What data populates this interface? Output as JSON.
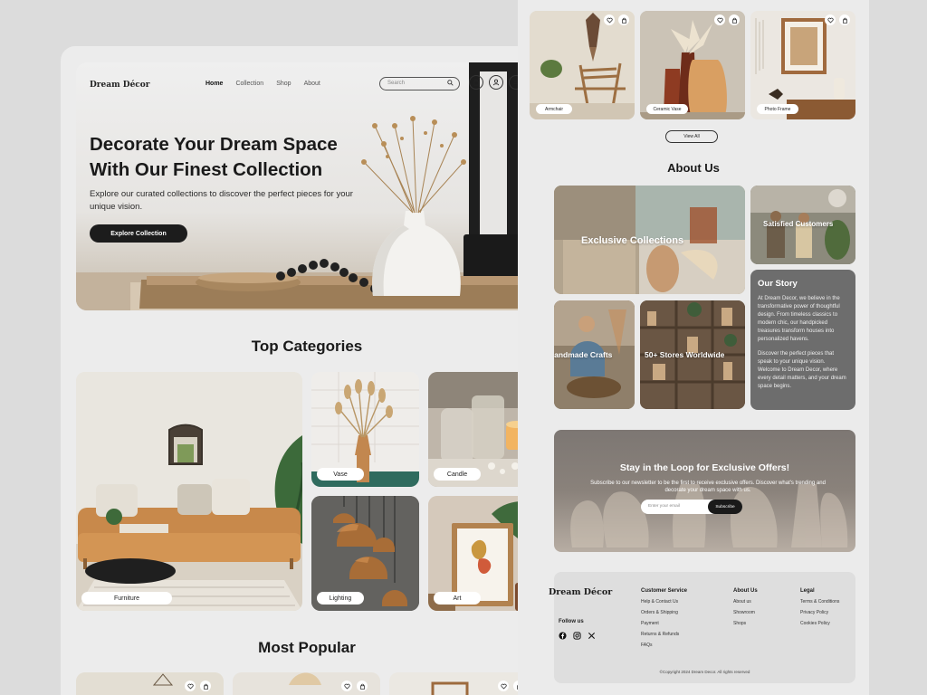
{
  "nav": {
    "logo": "Dream Décor",
    "links": [
      "Home",
      "Collection",
      "Shop",
      "About"
    ],
    "search_placeholder": "Search"
  },
  "hero": {
    "title": "Decorate Your Dream Space With Our Finest Collection",
    "subtitle": "Explore our curated collections to discover the perfect pieces for your unique vision.",
    "cta": "Explore Collection"
  },
  "categories": {
    "title": "Top Categories",
    "items": [
      "Furniture",
      "Vase",
      "Candle",
      "Lighting",
      "Art"
    ]
  },
  "popular": {
    "title": "Most Popular"
  },
  "products": {
    "items": [
      "Armchair",
      "Ceramic Vase",
      "Photo Frame"
    ],
    "view_all": "View All"
  },
  "about": {
    "title": "About Us",
    "tiles": [
      "Exclusive Collections",
      "Satisfied Customers",
      "Handmade Crafts",
      "50+ Stores Worldwide"
    ],
    "story_title": "Our Story",
    "story_p1": "At Dream Decor, we believe in the transformative power of thoughtful design. From timeless classics to modern chic, our handpicked treasures transform houses into personalized havens.",
    "story_p2": "Discover the perfect pieces that speak to your unique vision. Welcome to Dream Decor, where every detail matters, and your dream space begins."
  },
  "newsletter": {
    "title": "Stay in the Loop for Exclusive Offers!",
    "text": "Subscribe to our newsletter to be the first to receive exclusive offers. Discover what's trending and decorate your dream space with us.",
    "placeholder": "Enter your email",
    "button": "Subscribe"
  },
  "footer": {
    "logo": "Dream Décor",
    "follow": "Follow us",
    "customer_service": {
      "title": "Customer Service",
      "items": [
        "Help & Contact Us",
        "Orders & Shipping",
        "Payment",
        "Returns & Refunds",
        "FAQs"
      ]
    },
    "about_us": {
      "title": "About Us",
      "items": [
        "About us",
        "Showroom",
        "Shops"
      ]
    },
    "legal": {
      "title": "Legal",
      "items": [
        "Terms & Conditions",
        "Privacy Policy",
        "Cookies Policy"
      ]
    },
    "copyright": "©Copyright 2024 Dream Decor. All rights reserved"
  },
  "colors": {
    "dark": "#1c1c1c",
    "background": "#ececec",
    "accent_wood": "#c49a6c"
  }
}
